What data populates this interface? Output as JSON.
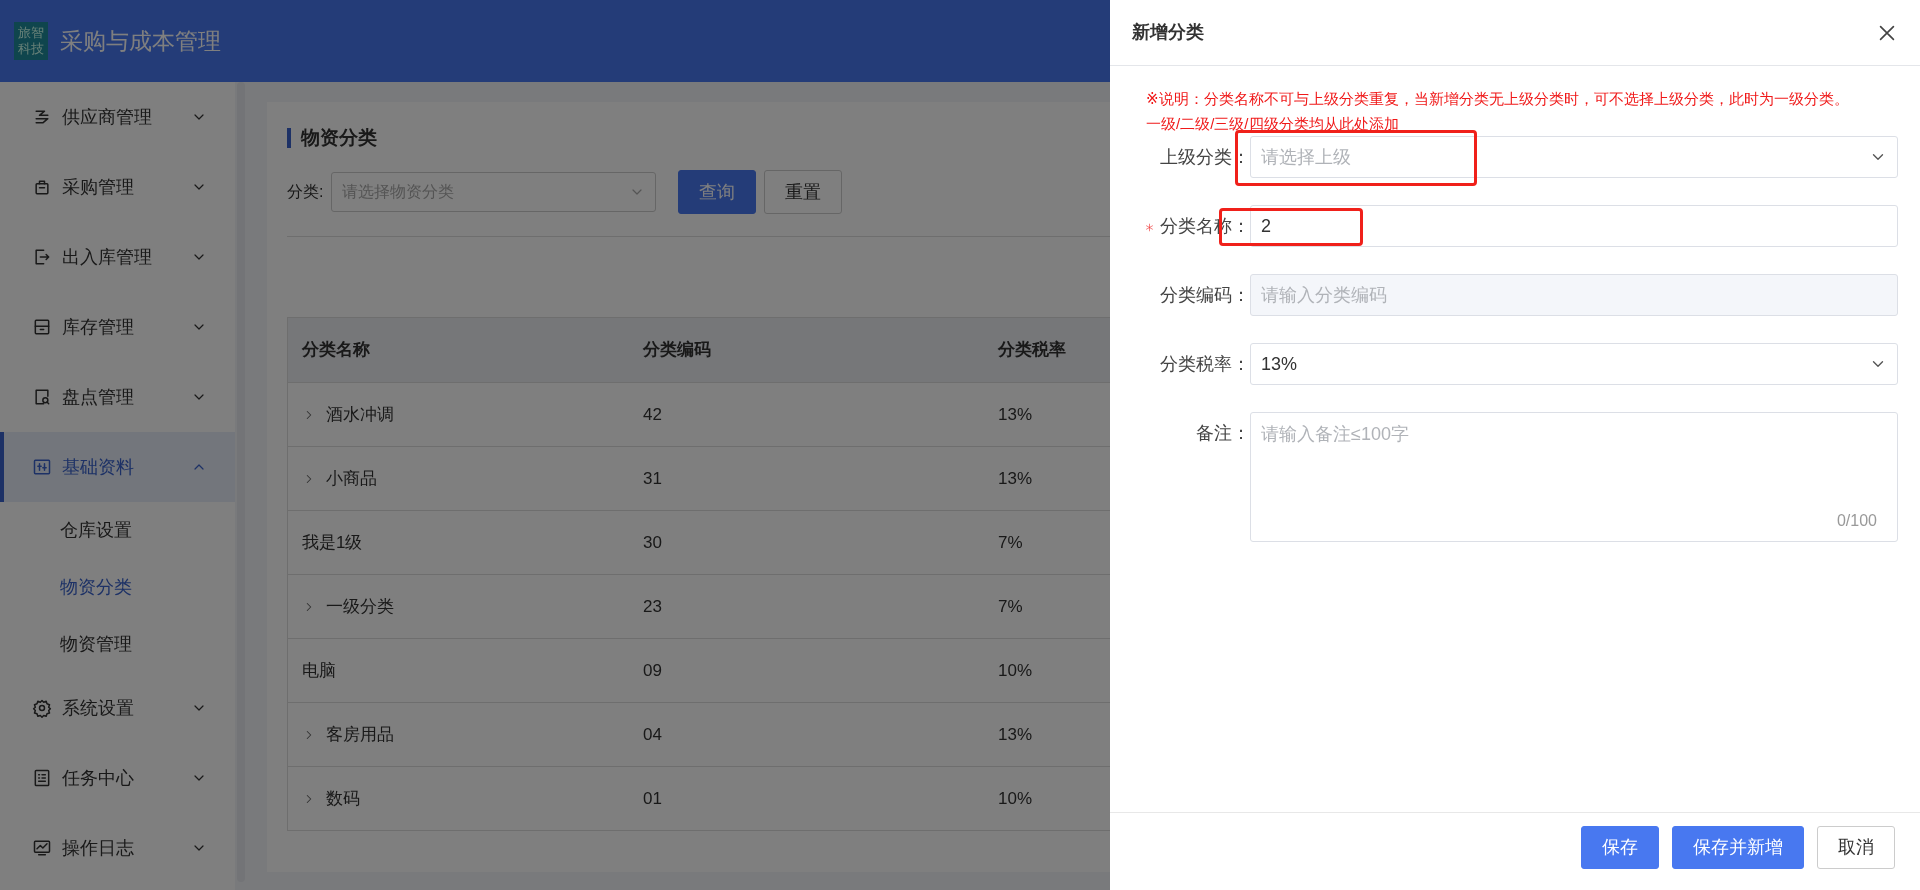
{
  "app": {
    "logo_lines": [
      "旅智",
      "科技"
    ],
    "title": "采购与成本管理"
  },
  "sidebar": {
    "items": [
      {
        "label": "供应商管理",
        "expanded": false,
        "selected": false
      },
      {
        "label": "采购管理",
        "expanded": false,
        "selected": false
      },
      {
        "label": "出入库管理",
        "expanded": false,
        "selected": false
      },
      {
        "label": "库存管理",
        "expanded": false,
        "selected": false
      },
      {
        "label": "盘点管理",
        "expanded": false,
        "selected": false
      },
      {
        "label": "基础资料",
        "expanded": true,
        "selected": true,
        "children": [
          {
            "label": "仓库设置",
            "selected": false
          },
          {
            "label": "物资分类",
            "selected": true
          },
          {
            "label": "物资管理",
            "selected": false
          }
        ]
      },
      {
        "label": "系统设置",
        "expanded": false,
        "selected": false
      },
      {
        "label": "任务中心",
        "expanded": false,
        "selected": false
      },
      {
        "label": "操作日志",
        "expanded": false,
        "selected": false
      }
    ]
  },
  "page": {
    "title": "物资分类",
    "filter_label": "分类:",
    "filter_placeholder": "请选择物资分类",
    "buttons": [
      {
        "label": "查询",
        "primary": true
      },
      {
        "label": "重置",
        "primary": false
      }
    ]
  },
  "table": {
    "columns": [
      "分类名称",
      "分类编码",
      "分类税率"
    ],
    "rows": [
      {
        "name": "酒水冲调",
        "code": "42",
        "rate": "13%",
        "expandable": true
      },
      {
        "name": "小商品",
        "code": "31",
        "rate": "13%",
        "expandable": true
      },
      {
        "name": "我是1级",
        "code": "30",
        "rate": "7%",
        "expandable": false
      },
      {
        "name": "一级分类",
        "code": "23",
        "rate": "7%",
        "expandable": true
      },
      {
        "name": "电脑",
        "code": "09",
        "rate": "10%",
        "expandable": false
      },
      {
        "name": "客房用品",
        "code": "04",
        "rate": "13%",
        "expandable": true
      },
      {
        "name": "数码",
        "code": "01",
        "rate": "10%",
        "expandable": true
      }
    ]
  },
  "drawer": {
    "title": "新增分类",
    "note": "※说明：分类名称不可与上级分类重复，当新增分类无上级分类时，可不选择上级分类，此时为一级分类。一级/二级/三级/四级分类均从此处添加",
    "fields": [
      {
        "kind": "select",
        "label": "上级分类：",
        "required": false,
        "placeholder": "请选择上级",
        "disabled": false,
        "annotated": true
      },
      {
        "kind": "input",
        "label": "分类名称：",
        "required": true,
        "value": "2",
        "disabled": false,
        "annotated": true
      },
      {
        "kind": "input",
        "label": "分类编码：",
        "required": false,
        "placeholder": "请输入分类编码",
        "disabled": true,
        "annotated": false
      },
      {
        "kind": "select",
        "label": "分类税率：",
        "required": false,
        "value": "13%",
        "disabled": false,
        "annotated": false
      },
      {
        "kind": "textarea",
        "label": "备注：",
        "required": false,
        "placeholder": "请输入备注≤100字",
        "counter": "0/100",
        "disabled": false,
        "annotated": false
      }
    ],
    "buttons": [
      {
        "label": "保存",
        "primary": true
      },
      {
        "label": "保存并新增",
        "primary": true
      },
      {
        "label": "取消",
        "primary": false
      }
    ]
  }
}
